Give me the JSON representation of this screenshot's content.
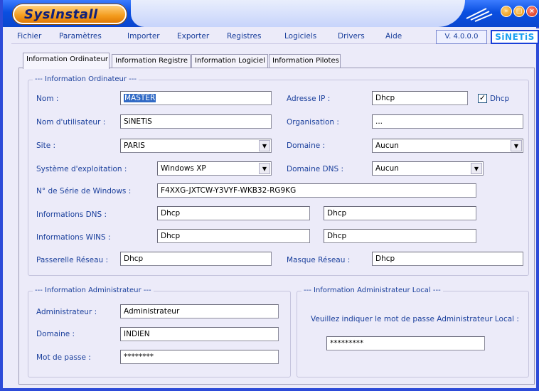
{
  "app": {
    "title": "SysInstall",
    "version": "V. 4.0.0.0",
    "brand": "SiNETiS"
  },
  "menu": [
    "Fichier",
    "Paramètres",
    "Importer",
    "Exporter",
    "Registres",
    "Logiciels",
    "Drivers",
    "Aide"
  ],
  "tabs": [
    "Information Ordinateur",
    "Information Registre",
    "Information Logiciel",
    "Information Pilotes"
  ],
  "computer": {
    "group_title": "--- Information Ordinateur ---",
    "nom_label": "Nom :",
    "nom_value": "MASTER",
    "ip_label": "Adresse IP :",
    "ip_value": "Dhcp",
    "dhcp_check_label": "Dhcp",
    "user_label": "Nom d'utilisateur :",
    "user_value": "SiNETiS",
    "org_label": "Organisation :",
    "org_value": "...",
    "site_label": "Site :",
    "site_value": "PARIS",
    "domain_label": "Domaine :",
    "domain_value": "Aucun",
    "os_label": "Système d'exploitation :",
    "os_value": "Windows XP",
    "dns_domain_label": "Domaine DNS :",
    "dns_domain_value": "Aucun",
    "serial_label": "N° de Série de Windows :",
    "serial_value": "F4XXG-JXTCW-Y3VYF-WKB32-RG9KG",
    "dns_label": "Informations DNS :",
    "dns1": "Dhcp",
    "dns2": "Dhcp",
    "wins_label": "Informations WINS :",
    "wins1": "Dhcp",
    "wins2": "Dhcp",
    "gateway_label": "Passerelle Réseau :",
    "gateway_value": "Dhcp",
    "mask_label": "Masque Réseau :",
    "mask_value": "Dhcp"
  },
  "admin": {
    "group_title": "--- Information Administrateur ---",
    "admin_label": "Administrateur :",
    "admin_value": "Administrateur",
    "domain_label": "Domaine :",
    "domain_value": "INDIEN",
    "pass_label": "Mot de passe :",
    "pass_value": "********"
  },
  "local_admin": {
    "group_title": "--- Information Administrateur Local ---",
    "prompt": "Veuillez indiquer le mot de passe Administrateur Local :",
    "pass_value": "*********"
  }
}
